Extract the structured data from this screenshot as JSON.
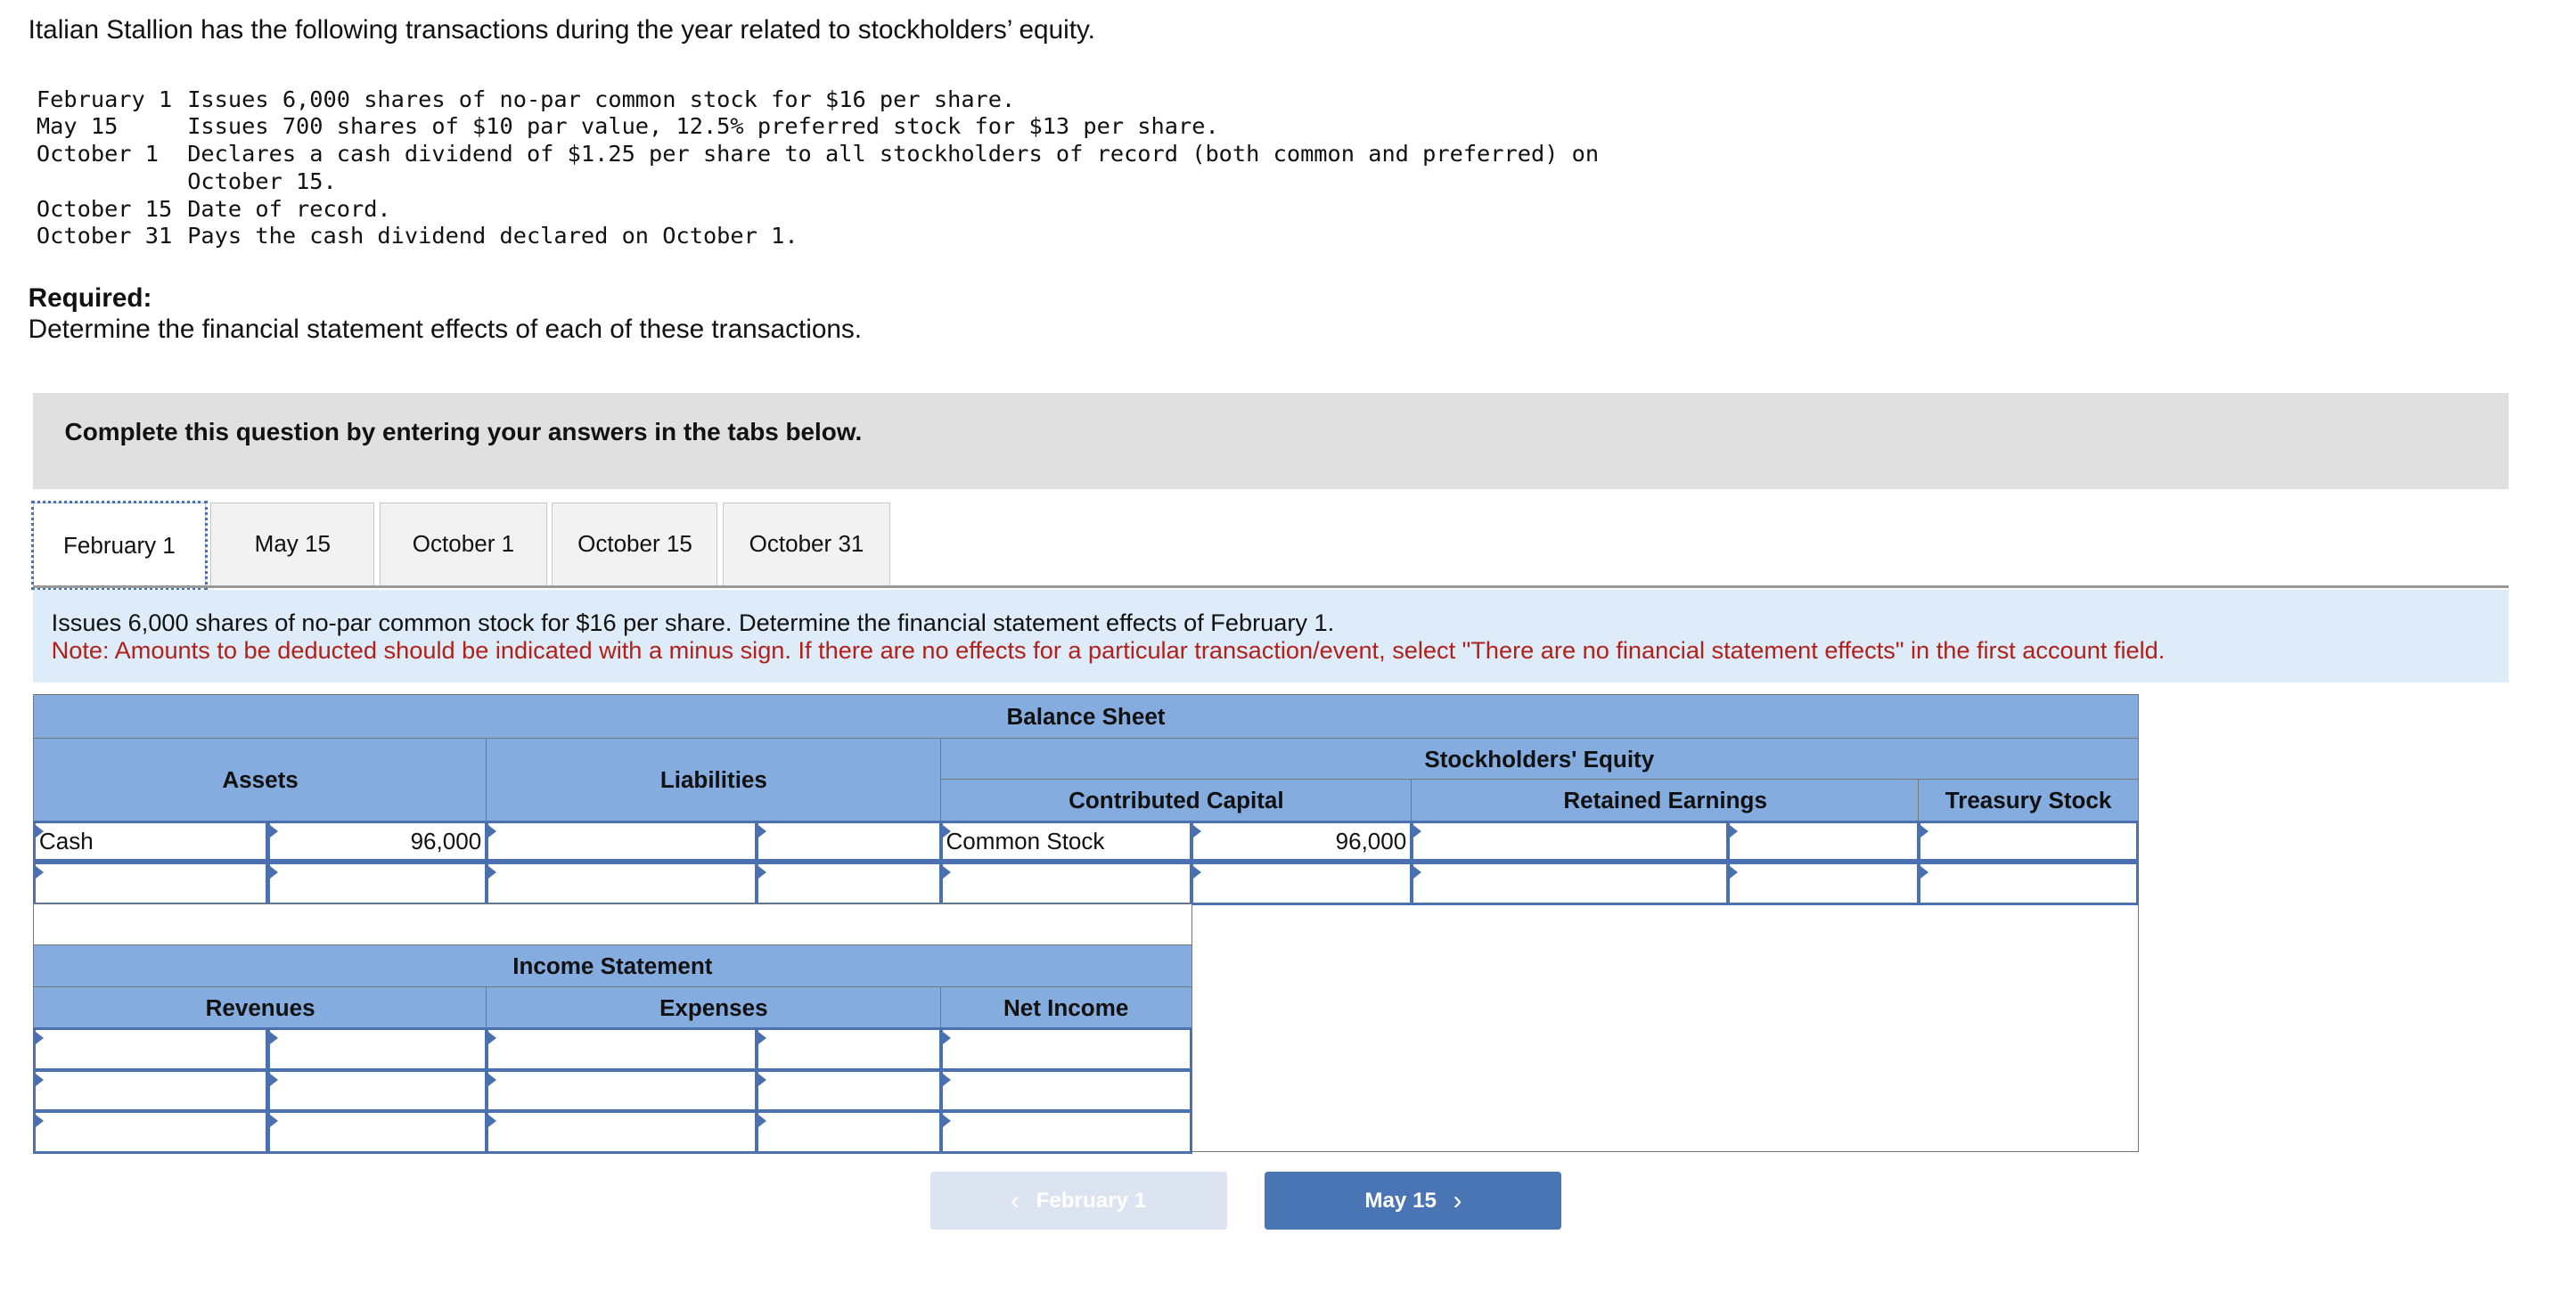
{
  "intro": "Italian Stallion has the following transactions during the year related to stockholders’ equity.",
  "transactions": [
    {
      "date": "February 1",
      "text": "Issues 6,000 shares of no-par common stock for $16 per share."
    },
    {
      "date": "May 15",
      "text": "Issues 700 shares of $10 par value, 12.5% preferred stock for $13 per share."
    },
    {
      "date": "October 1",
      "text": "Declares a cash dividend of $1.25 per share to all stockholders of record (both common and preferred) on"
    },
    {
      "date": "",
      "text": "October 15."
    },
    {
      "date": "October 15",
      "text": "Date of record."
    },
    {
      "date": "October 31",
      "text": "Pays the cash dividend declared on October 1."
    }
  ],
  "required_label": "Required:",
  "required_text": "Determine the financial statement effects of each of these transactions.",
  "instruction": "Complete this question by entering your answers in the tabs below.",
  "tabs": [
    "February 1",
    "May 15",
    "October 1",
    "October 15",
    "October 31"
  ],
  "active_tab": "February 1",
  "question": "Issues 6,000 shares of no-par common stock for $16 per share. Determine the financial statement effects of February 1.",
  "note": "Note: Amounts to be deducted should be indicated with a minus sign. If there are no effects for a particular transaction/event, select \"There are no financial statement effects\" in the first account field.",
  "balance_sheet": {
    "title": "Balance Sheet",
    "assets": "Assets",
    "liabilities": "Liabilities",
    "equity": "Stockholders' Equity",
    "contributed_capital": "Contributed Capital",
    "retained_earnings": "Retained Earnings",
    "treasury_stock": "Treasury Stock",
    "rows": [
      {
        "asset_account": "Cash",
        "asset_amount": "96,000",
        "liab_account": "",
        "liab_amount": "",
        "cc_account": "Common Stock",
        "cc_amount": "96,000",
        "re_account": "",
        "re_amount": "",
        "ts_amount": ""
      },
      {
        "asset_account": "",
        "asset_amount": "",
        "liab_account": "",
        "liab_amount": "",
        "cc_account": "",
        "cc_amount": "",
        "re_account": "",
        "re_amount": "",
        "ts_amount": ""
      }
    ]
  },
  "income_statement": {
    "title": "Income Statement",
    "revenues": "Revenues",
    "expenses": "Expenses",
    "net_income": "Net Income"
  },
  "nav": {
    "prev": "February 1",
    "next": "May 15"
  },
  "colors": {
    "header": "#85acdf",
    "cell_border": "#4a70b0",
    "next_button": "#4a75b4",
    "note": "#b2201a"
  }
}
